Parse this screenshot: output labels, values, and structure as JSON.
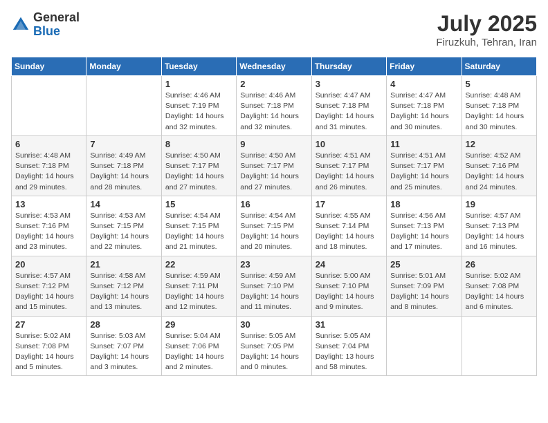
{
  "header": {
    "logo_general": "General",
    "logo_blue": "Blue",
    "month_year": "July 2025",
    "location": "Firuzkuh, Tehran, Iran"
  },
  "weekdays": [
    "Sunday",
    "Monday",
    "Tuesday",
    "Wednesday",
    "Thursday",
    "Friday",
    "Saturday"
  ],
  "weeks": [
    [
      {
        "day": "",
        "info": ""
      },
      {
        "day": "",
        "info": ""
      },
      {
        "day": "1",
        "info": "Sunrise: 4:46 AM\nSunset: 7:19 PM\nDaylight: 14 hours\nand 32 minutes."
      },
      {
        "day": "2",
        "info": "Sunrise: 4:46 AM\nSunset: 7:18 PM\nDaylight: 14 hours\nand 32 minutes."
      },
      {
        "day": "3",
        "info": "Sunrise: 4:47 AM\nSunset: 7:18 PM\nDaylight: 14 hours\nand 31 minutes."
      },
      {
        "day": "4",
        "info": "Sunrise: 4:47 AM\nSunset: 7:18 PM\nDaylight: 14 hours\nand 30 minutes."
      },
      {
        "day": "5",
        "info": "Sunrise: 4:48 AM\nSunset: 7:18 PM\nDaylight: 14 hours\nand 30 minutes."
      }
    ],
    [
      {
        "day": "6",
        "info": "Sunrise: 4:48 AM\nSunset: 7:18 PM\nDaylight: 14 hours\nand 29 minutes."
      },
      {
        "day": "7",
        "info": "Sunrise: 4:49 AM\nSunset: 7:18 PM\nDaylight: 14 hours\nand 28 minutes."
      },
      {
        "day": "8",
        "info": "Sunrise: 4:50 AM\nSunset: 7:17 PM\nDaylight: 14 hours\nand 27 minutes."
      },
      {
        "day": "9",
        "info": "Sunrise: 4:50 AM\nSunset: 7:17 PM\nDaylight: 14 hours\nand 27 minutes."
      },
      {
        "day": "10",
        "info": "Sunrise: 4:51 AM\nSunset: 7:17 PM\nDaylight: 14 hours\nand 26 minutes."
      },
      {
        "day": "11",
        "info": "Sunrise: 4:51 AM\nSunset: 7:17 PM\nDaylight: 14 hours\nand 25 minutes."
      },
      {
        "day": "12",
        "info": "Sunrise: 4:52 AM\nSunset: 7:16 PM\nDaylight: 14 hours\nand 24 minutes."
      }
    ],
    [
      {
        "day": "13",
        "info": "Sunrise: 4:53 AM\nSunset: 7:16 PM\nDaylight: 14 hours\nand 23 minutes."
      },
      {
        "day": "14",
        "info": "Sunrise: 4:53 AM\nSunset: 7:15 PM\nDaylight: 14 hours\nand 22 minutes."
      },
      {
        "day": "15",
        "info": "Sunrise: 4:54 AM\nSunset: 7:15 PM\nDaylight: 14 hours\nand 21 minutes."
      },
      {
        "day": "16",
        "info": "Sunrise: 4:54 AM\nSunset: 7:15 PM\nDaylight: 14 hours\nand 20 minutes."
      },
      {
        "day": "17",
        "info": "Sunrise: 4:55 AM\nSunset: 7:14 PM\nDaylight: 14 hours\nand 18 minutes."
      },
      {
        "day": "18",
        "info": "Sunrise: 4:56 AM\nSunset: 7:13 PM\nDaylight: 14 hours\nand 17 minutes."
      },
      {
        "day": "19",
        "info": "Sunrise: 4:57 AM\nSunset: 7:13 PM\nDaylight: 14 hours\nand 16 minutes."
      }
    ],
    [
      {
        "day": "20",
        "info": "Sunrise: 4:57 AM\nSunset: 7:12 PM\nDaylight: 14 hours\nand 15 minutes."
      },
      {
        "day": "21",
        "info": "Sunrise: 4:58 AM\nSunset: 7:12 PM\nDaylight: 14 hours\nand 13 minutes."
      },
      {
        "day": "22",
        "info": "Sunrise: 4:59 AM\nSunset: 7:11 PM\nDaylight: 14 hours\nand 12 minutes."
      },
      {
        "day": "23",
        "info": "Sunrise: 4:59 AM\nSunset: 7:10 PM\nDaylight: 14 hours\nand 11 minutes."
      },
      {
        "day": "24",
        "info": "Sunrise: 5:00 AM\nSunset: 7:10 PM\nDaylight: 14 hours\nand 9 minutes."
      },
      {
        "day": "25",
        "info": "Sunrise: 5:01 AM\nSunset: 7:09 PM\nDaylight: 14 hours\nand 8 minutes."
      },
      {
        "day": "26",
        "info": "Sunrise: 5:02 AM\nSunset: 7:08 PM\nDaylight: 14 hours\nand 6 minutes."
      }
    ],
    [
      {
        "day": "27",
        "info": "Sunrise: 5:02 AM\nSunset: 7:08 PM\nDaylight: 14 hours\nand 5 minutes."
      },
      {
        "day": "28",
        "info": "Sunrise: 5:03 AM\nSunset: 7:07 PM\nDaylight: 14 hours\nand 3 minutes."
      },
      {
        "day": "29",
        "info": "Sunrise: 5:04 AM\nSunset: 7:06 PM\nDaylight: 14 hours\nand 2 minutes."
      },
      {
        "day": "30",
        "info": "Sunrise: 5:05 AM\nSunset: 7:05 PM\nDaylight: 14 hours\nand 0 minutes."
      },
      {
        "day": "31",
        "info": "Sunrise: 5:05 AM\nSunset: 7:04 PM\nDaylight: 13 hours\nand 58 minutes."
      },
      {
        "day": "",
        "info": ""
      },
      {
        "day": "",
        "info": ""
      }
    ]
  ]
}
